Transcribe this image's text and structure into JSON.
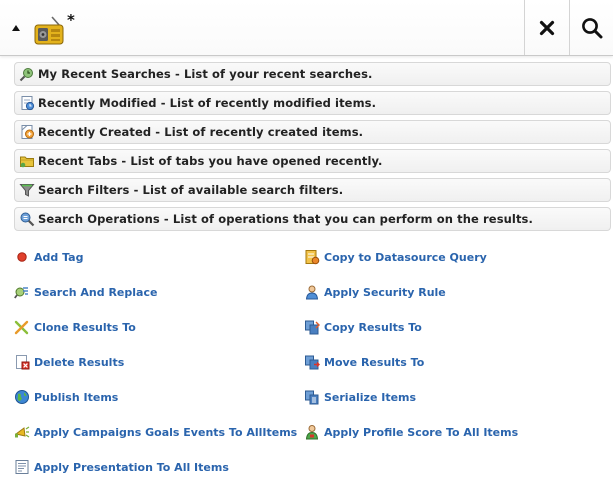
{
  "search": {
    "query": "*",
    "toggle_icon": "triangle-up-icon",
    "app_icon": "radio-icon",
    "clear_icon": "close-icon",
    "search_icon": "magnifier-icon"
  },
  "sections": [
    {
      "icon": "recent-searches-icon",
      "label": "My Recent Searches - List of your recent searches."
    },
    {
      "icon": "recently-modified-icon",
      "label": "Recently Modified - List of recently modified items."
    },
    {
      "icon": "recently-created-icon",
      "label": "Recently Created - List of recently created items."
    },
    {
      "icon": "recent-tabs-icon",
      "label": "Recent Tabs - List of tabs you have opened recently."
    },
    {
      "icon": "search-filters-icon",
      "label": "Search Filters - List of available search filters."
    },
    {
      "icon": "search-operations-icon",
      "label": "Search Operations - List of operations that you can perform on the results."
    }
  ],
  "operations": {
    "left": [
      {
        "icon": "red-dot-icon",
        "label": "Add Tag"
      },
      {
        "icon": "search-replace-icon",
        "label": "Search And Replace"
      },
      {
        "icon": "clone-icon",
        "label": "Clone Results To"
      },
      {
        "icon": "delete-results-icon",
        "label": "Delete Results"
      },
      {
        "icon": "globe-icon",
        "label": "Publish Items"
      },
      {
        "icon": "campaign-icon",
        "label": "Apply Campaigns Goals Events To AllItems"
      },
      {
        "icon": "presentation-icon",
        "label": "Apply Presentation To All Items"
      }
    ],
    "right": [
      {
        "icon": "datasource-query-icon",
        "label": "Copy to Datasource Query"
      },
      {
        "icon": "security-rule-icon",
        "label": "Apply Security Rule"
      },
      {
        "icon": "copy-results-icon",
        "label": "Copy Results To"
      },
      {
        "icon": "move-results-icon",
        "label": "Move Results To"
      },
      {
        "icon": "serialize-icon",
        "label": "Serialize Items"
      },
      {
        "icon": "profile-score-icon",
        "label": "Apply Profile Score To All Items"
      }
    ]
  }
}
